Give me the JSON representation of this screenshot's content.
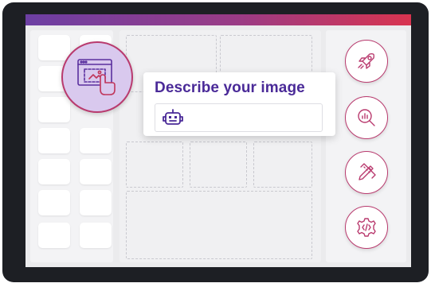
{
  "card": {
    "title": "Describe your image",
    "input_icon": "robot-icon"
  },
  "badge": {
    "icon": "image-select-hand-icon"
  },
  "sidebar_right": {
    "items": [
      {
        "icon": "rocket-icon"
      },
      {
        "icon": "search-analytics-icon"
      },
      {
        "icon": "pencil-ruler-icon"
      },
      {
        "icon": "gear-code-icon"
      }
    ]
  },
  "colors": {
    "device_frame": "#1d1f24",
    "gradient_start": "#6c3fa3",
    "gradient_end": "#d8344f",
    "accent": "#b93a6e",
    "title": "#4a2a98",
    "badge_fill": "#d9c9ee"
  }
}
